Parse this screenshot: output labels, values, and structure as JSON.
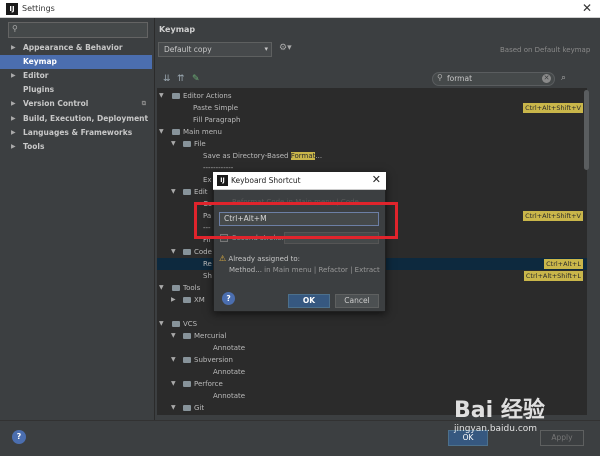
{
  "window": {
    "title": "Settings"
  },
  "left": {
    "search_placeholder": "",
    "items": [
      {
        "label": "Appearance & Behavior",
        "arrow": "▶"
      },
      {
        "label": "Keymap",
        "arrow": ""
      },
      {
        "label": "Editor",
        "arrow": "▶"
      },
      {
        "label": "Plugins",
        "arrow": ""
      },
      {
        "label": "Version Control",
        "arrow": "▶"
      },
      {
        "label": "Build, Execution, Deployment",
        "arrow": "▶"
      },
      {
        "label": "Languages & Frameworks",
        "arrow": "▶"
      },
      {
        "label": "Tools",
        "arrow": "▶"
      }
    ]
  },
  "keymap": {
    "title": "Keymap",
    "selected_keymap": "Default copy",
    "based_on": "Based on Default keymap",
    "search_value": "format"
  },
  "tree": {
    "editor_actions": "Editor Actions",
    "paste_simple": "Paste Simple",
    "paste_simple_sc": "Ctrl+Alt+Shift+V",
    "fill_paragraph": "Fill Paragraph",
    "main_menu": "Main menu",
    "file": "File",
    "save_as_prefix": "Save as Directory-Based ",
    "save_as_hl": "Format",
    "save_as_suffix": "...",
    "dashes": "------------",
    "ex": "Ex",
    "edit": "Edit",
    "co": "Co",
    "pa": "Pa",
    "pa_sc": "Ctrl+Alt+Shift+V",
    "dash2": "---",
    "fil": "Fil",
    "code": "Code",
    "re": "Re",
    "re_sc": "Ctrl+Alt+L",
    "sh": "Sh",
    "sh_sc": "Ctrl+Alt+Shift+L",
    "tools": "Tools",
    "xm": "XM",
    "vcs": "VCS",
    "mercurial": "Mercurial",
    "annotate": "Annotate",
    "subversion": "Subversion",
    "perforce": "Perforce",
    "git": "Git"
  },
  "dialog": {
    "title": "Keyboard Shortcut",
    "ghost": "Reformat Code in Main menu | Code",
    "shortcut": "Ctrl+Alt+M",
    "second_stroke": "Second stroke:",
    "already": "Already assigned to:",
    "assigned_action": "Method...",
    "assigned_path": " in Main menu | Refactor | Extract",
    "ok": "OK",
    "cancel": "Cancel"
  },
  "bottom": {
    "ok": "OK",
    "apply": "Apply"
  },
  "watermark": {
    "brand": "Bai 经验",
    "url": "jingyan.baidu.com"
  }
}
